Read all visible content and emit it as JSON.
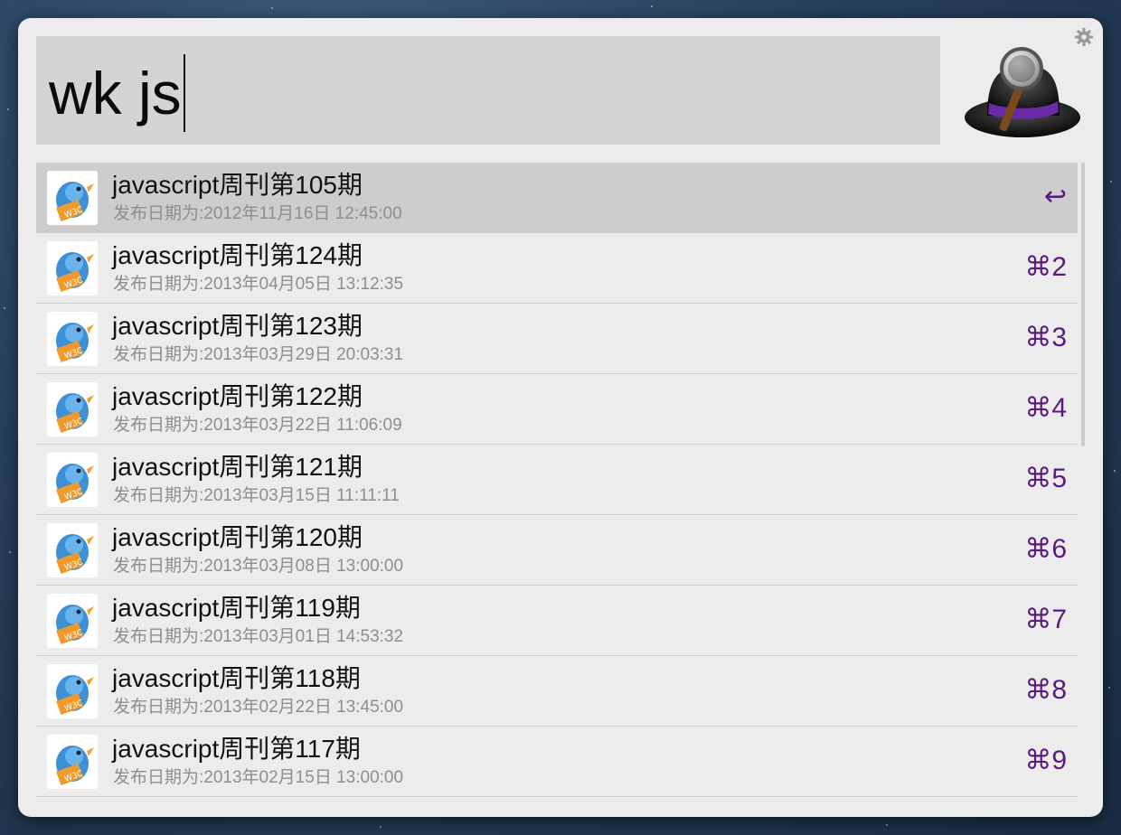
{
  "search": {
    "query": "wk js"
  },
  "shortcut_color": "#5a1a80",
  "results": [
    {
      "title": "javascript周刊第105期",
      "subtitle": "发布日期为:2012年11月16日 12:45:00",
      "shortcut": "↩",
      "selected": true,
      "icon": "w3c-bird-icon"
    },
    {
      "title": "javascript周刊第124期",
      "subtitle": "发布日期为:2013年04月05日 13:12:35",
      "shortcut": "⌘2",
      "selected": false,
      "icon": "w3c-bird-icon"
    },
    {
      "title": "javascript周刊第123期",
      "subtitle": "发布日期为:2013年03月29日 20:03:31",
      "shortcut": "⌘3",
      "selected": false,
      "icon": "w3c-bird-icon"
    },
    {
      "title": "javascript周刊第122期",
      "subtitle": "发布日期为:2013年03月22日 11:06:09",
      "shortcut": "⌘4",
      "selected": false,
      "icon": "w3c-bird-icon"
    },
    {
      "title": "javascript周刊第121期",
      "subtitle": "发布日期为:2013年03月15日 11:11:11",
      "shortcut": "⌘5",
      "selected": false,
      "icon": "w3c-bird-icon"
    },
    {
      "title": "javascript周刊第120期",
      "subtitle": "发布日期为:2013年03月08日 13:00:00",
      "shortcut": "⌘6",
      "selected": false,
      "icon": "w3c-bird-icon"
    },
    {
      "title": "javascript周刊第119期",
      "subtitle": "发布日期为:2013年03月01日 14:53:32",
      "shortcut": "⌘7",
      "selected": false,
      "icon": "w3c-bird-icon"
    },
    {
      "title": "javascript周刊第118期",
      "subtitle": "发布日期为:2013年02月22日 13:45:00",
      "shortcut": "⌘8",
      "selected": false,
      "icon": "w3c-bird-icon"
    },
    {
      "title": "javascript周刊第117期",
      "subtitle": "发布日期为:2013年02月15日 13:00:00",
      "shortcut": "⌘9",
      "selected": false,
      "icon": "w3c-bird-icon"
    }
  ]
}
